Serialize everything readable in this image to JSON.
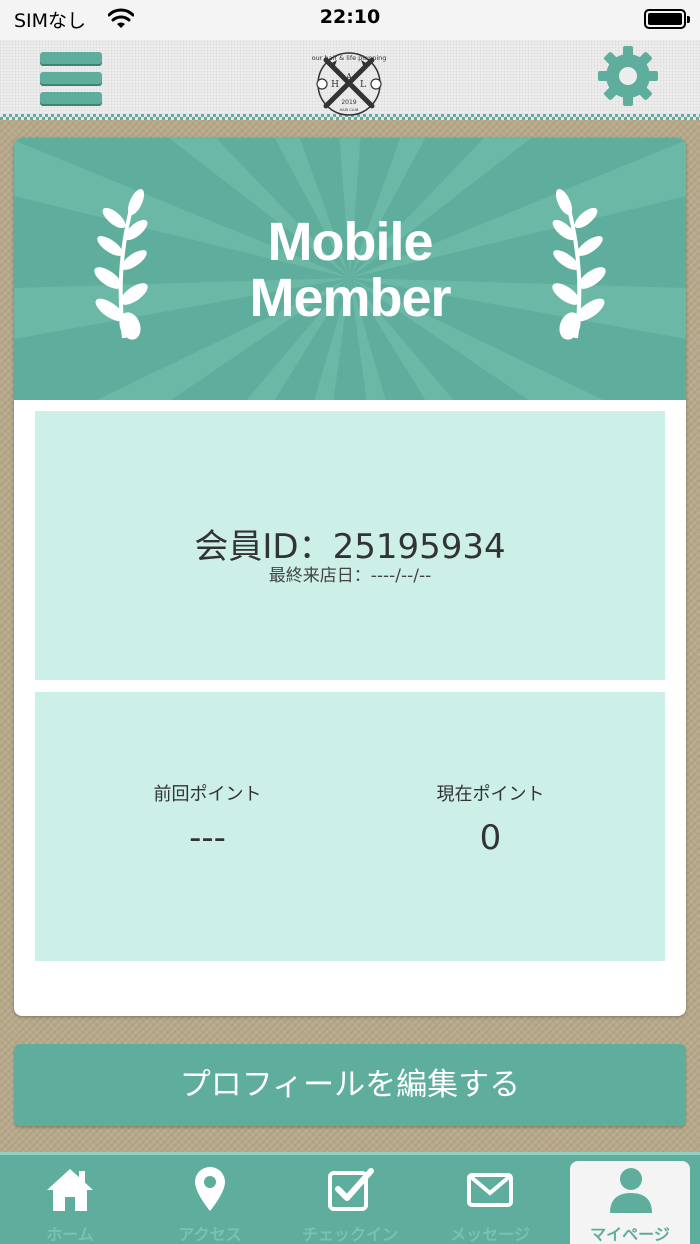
{
  "status_bar": {
    "carrier": "SIMなし",
    "time": "22:10"
  },
  "header": {
    "menu_icon": "hamburger-menu-icon",
    "logo_text_top": "our hair & life planning",
    "logo_letters": [
      "A",
      "H",
      "L"
    ],
    "logo_year": "2019",
    "logo_bottom": "HAIR CLUB",
    "settings_icon": "gear-icon"
  },
  "member_card": {
    "banner_title_line1": "Mobile",
    "banner_title_line2": "Member",
    "member_id_label": "会員ID：25195934",
    "last_visit": "最終来店日：----/--/--",
    "points": [
      {
        "label": "前回ポイント",
        "value": "---"
      },
      {
        "label": "現在ポイント",
        "value": "0"
      }
    ]
  },
  "edit_profile_button": "プロフィールを編集する",
  "tab_bar": {
    "items": [
      {
        "label": "ホーム",
        "icon": "home-icon"
      },
      {
        "label": "アクセス",
        "icon": "map-pin-icon"
      },
      {
        "label": "チェックイン",
        "icon": "checkbox-icon"
      },
      {
        "label": "メッセージ",
        "icon": "envelope-icon"
      },
      {
        "label": "マイページ",
        "icon": "person-icon"
      }
    ],
    "active_index": 4
  },
  "colors": {
    "accent": "#5fae9d",
    "panel": "#ccefe7",
    "background": "#b7a98a"
  }
}
